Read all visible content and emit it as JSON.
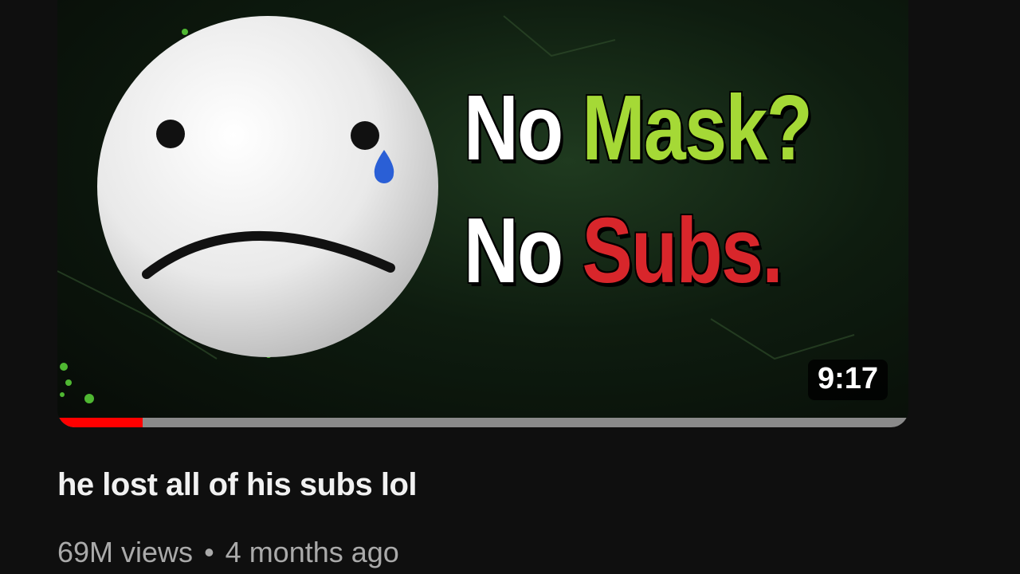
{
  "video": {
    "thumbnail": {
      "headline_line1": [
        "No",
        "Mask?"
      ],
      "headline_line2": [
        "No",
        "Subs."
      ],
      "colors": {
        "white_text": "#ffffff",
        "green_text": "#a5d936",
        "red_text": "#d8262b",
        "background": "#0e1c0f"
      },
      "face_icon": "sad-face-crying-icon"
    },
    "duration": "9:17",
    "watch_progress": 0.1,
    "title": "he lost all of his subs lol",
    "views": "69M views",
    "separator": "•",
    "age": "4 months ago"
  },
  "colors": {
    "page_background": "#0f0f0f",
    "progress_red": "#ff0000",
    "meta_text": "#aaaaaa"
  }
}
